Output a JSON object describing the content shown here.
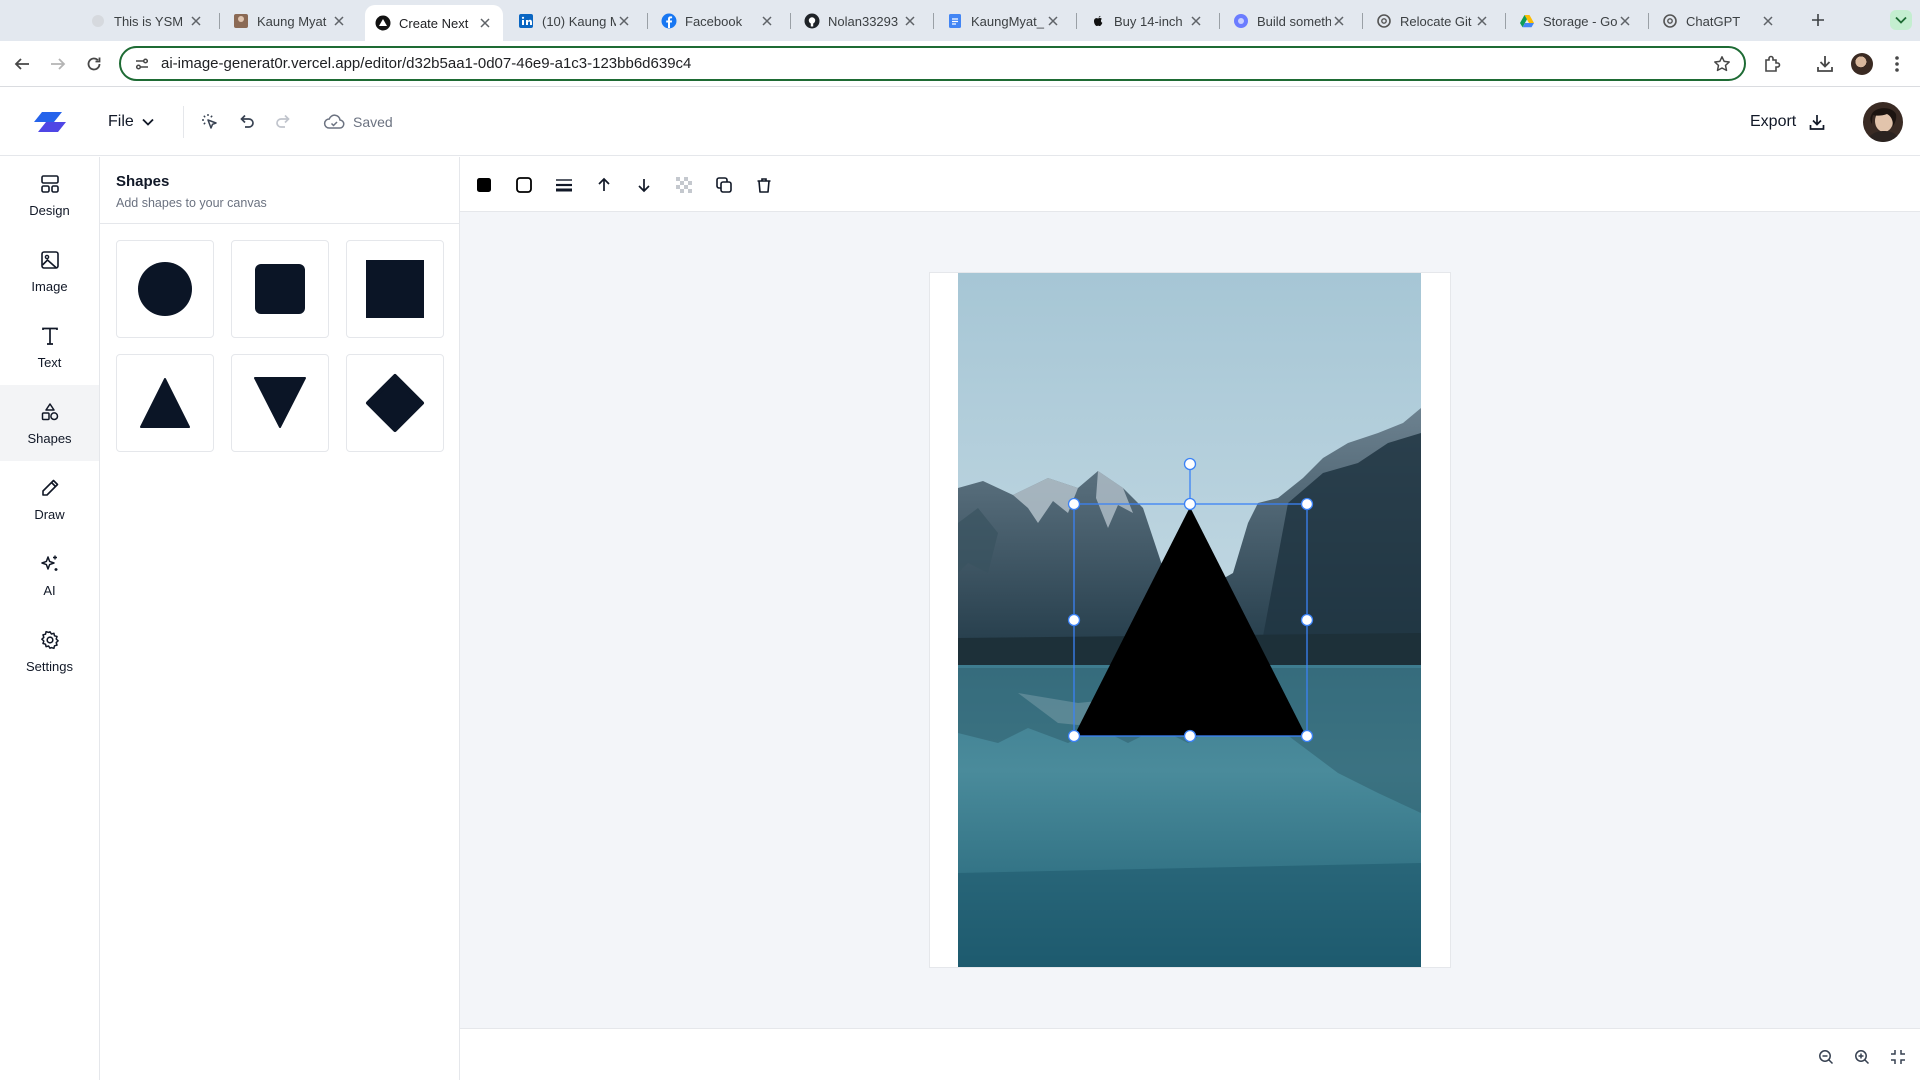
{
  "browser": {
    "tabs": [
      {
        "title": "This is YSM",
        "icon": "app-icon"
      },
      {
        "title": "Kaung Myat",
        "icon": "photo-favicon"
      },
      {
        "title": "Create Next",
        "icon": "vercel-icon",
        "active": true
      },
      {
        "title": "(10) Kaung M",
        "icon": "linkedin-icon"
      },
      {
        "title": "Facebook",
        "icon": "facebook-icon"
      },
      {
        "title": "Nolan33293",
        "icon": "github-icon"
      },
      {
        "title": "KaungMyat_",
        "icon": "docs-icon"
      },
      {
        "title": "Buy 14-inch",
        "icon": "apple-icon"
      },
      {
        "title": "Build someth",
        "icon": "globe-icon"
      },
      {
        "title": "Relocate Git",
        "icon": "chatgpt-icon"
      },
      {
        "title": "Storage - Go",
        "icon": "drive-icon"
      },
      {
        "title": "ChatGPT",
        "icon": "chatgpt-icon"
      }
    ],
    "url": "ai-image-generat0r.vercel.app/editor/d32b5aa1-0d07-46e9-a1c3-123bb6d639c4"
  },
  "header": {
    "file_label": "File",
    "status": "Saved",
    "export_label": "Export"
  },
  "sidebar": {
    "items": [
      {
        "label": "Design",
        "icon": "layout-icon"
      },
      {
        "label": "Image",
        "icon": "image-icon"
      },
      {
        "label": "Text",
        "icon": "text-icon"
      },
      {
        "label": "Shapes",
        "icon": "shapes-icon",
        "active": true
      },
      {
        "label": "Draw",
        "icon": "pencil-icon"
      },
      {
        "label": "AI",
        "icon": "sparkles-icon"
      },
      {
        "label": "Settings",
        "icon": "gear-icon"
      }
    ]
  },
  "panel": {
    "title": "Shapes",
    "subtitle": "Add shapes to your canvas",
    "shapes": [
      "circle",
      "rounded-square",
      "square",
      "triangle",
      "inverted-triangle",
      "diamond"
    ]
  },
  "colors": {
    "accent": "#3b82f6",
    "shape_fill": "#0b1526",
    "selected_shape_fill": "#000000"
  }
}
